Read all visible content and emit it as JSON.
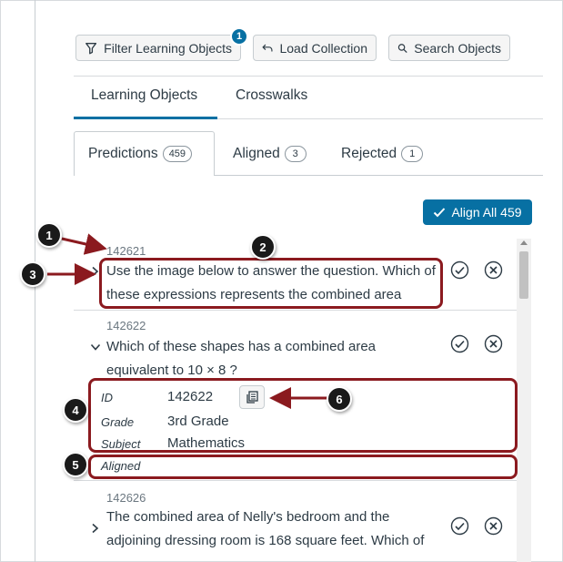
{
  "toolbar": {
    "filter_label": "Filter Learning Objects",
    "filter_badge": "1",
    "load_label": "Load Collection",
    "search_label": "Search Objects"
  },
  "main_tabs": [
    {
      "label": "Learning Objects",
      "active": true
    },
    {
      "label": "Crosswalks",
      "active": false
    }
  ],
  "sub_tabs": [
    {
      "label": "Predictions",
      "count": "459",
      "active": true
    },
    {
      "label": "Aligned",
      "count": "3",
      "active": false
    },
    {
      "label": "Rejected",
      "count": "1",
      "active": false
    }
  ],
  "align_all_label": "Align All 459",
  "items": [
    {
      "id": "142621",
      "text": "Use the image below to answer the question. Which of these expressions represents the combined area",
      "expanded": false
    },
    {
      "id": "142622",
      "text": "Which of these shapes has a combined area equivalent to 10 × 8 ?",
      "expanded": true,
      "details": {
        "id_label": "ID",
        "id_value": "142622",
        "grade_label": "Grade",
        "grade_value": "3rd Grade",
        "subject_label": "Subject",
        "subject_value": "Mathematics",
        "status": "Aligned"
      }
    },
    {
      "id": "142626",
      "text": "The combined area of Nelly's bedroom and the adjoining dressing room is 168 square feet. Which of",
      "expanded": false
    }
  ],
  "callouts": [
    "1",
    "2",
    "3",
    "4",
    "5",
    "6"
  ],
  "colors": {
    "accent": "#0770a3",
    "callout": "#8b1a1f",
    "text": "#2d3b45"
  }
}
